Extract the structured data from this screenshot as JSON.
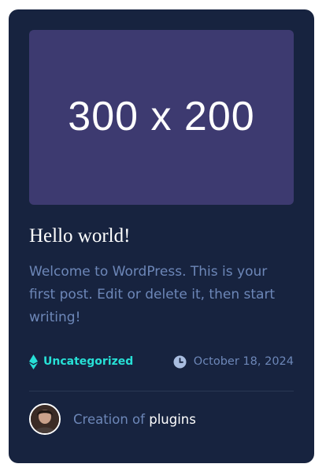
{
  "post": {
    "thumbnail_text": "300 x 200",
    "title": "Hello world!",
    "excerpt": "Welcome to WordPress. This is your first post. Edit or delete it, then start writing!",
    "category": "Uncategorized",
    "date": "October 18, 2024",
    "author_prefix": "Creation of",
    "author_name": "plugins"
  },
  "colors": {
    "card_background": "#17233f",
    "thumbnail_background": "#3d3a70",
    "accent": "#27e0d6",
    "muted_text": "#6d87b8"
  },
  "icons": {
    "category": "diamond-icon",
    "date": "clock-icon",
    "avatar": "author-avatar"
  }
}
